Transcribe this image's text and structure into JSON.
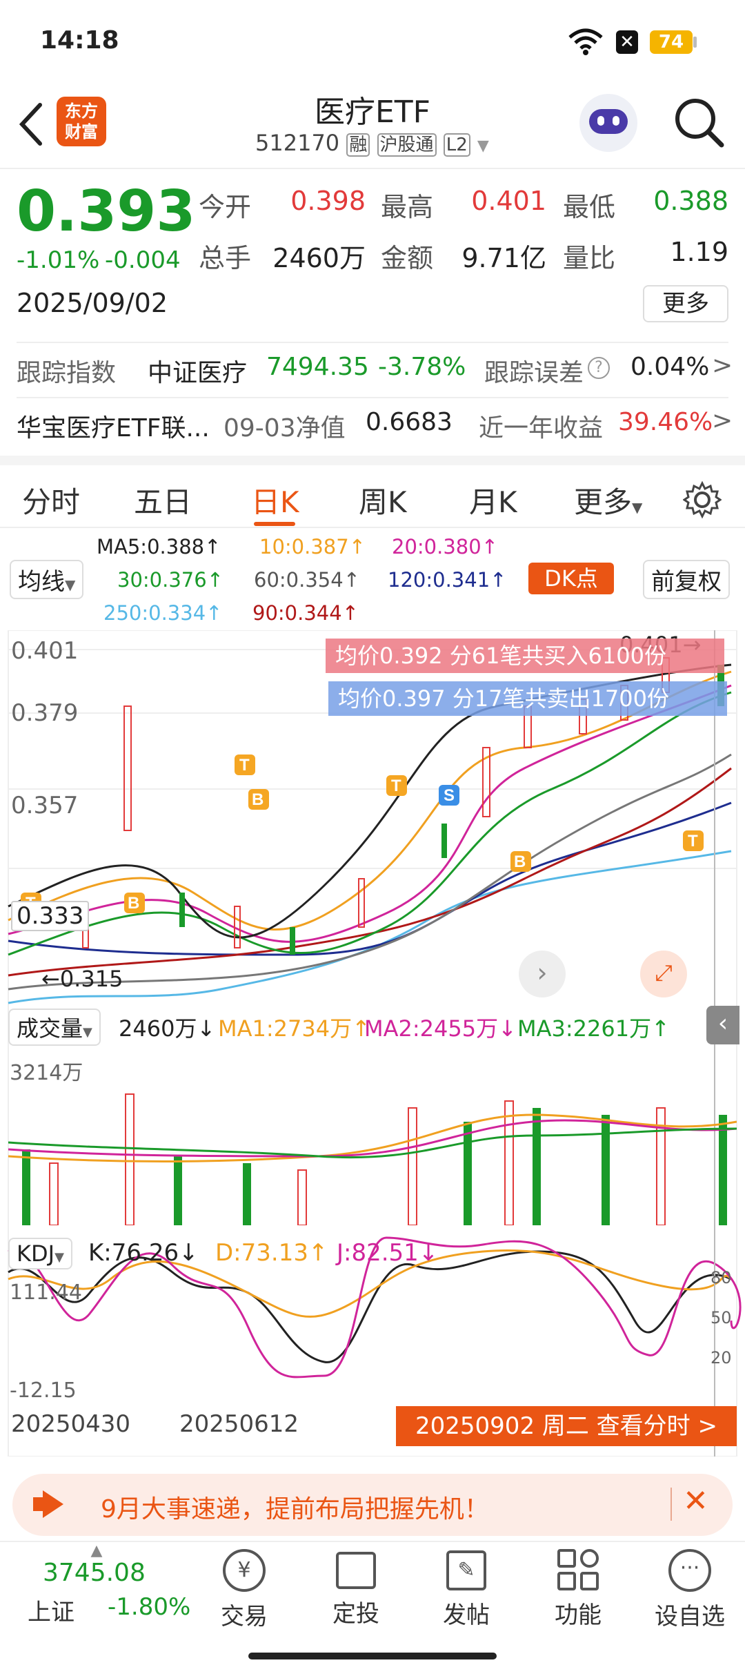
{
  "status_bar": {
    "time": "14:18",
    "battery": "74"
  },
  "header": {
    "logo_line1": "东方",
    "logo_line2": "财富",
    "title": "医疗ETF",
    "code": "512170",
    "tag_margin": "融",
    "tag_connect": "沪股通",
    "tag_level": "L2"
  },
  "quote": {
    "price": "0.393",
    "change_pct": "-1.01%",
    "change": "-0.004",
    "date": "2025/09/02",
    "open_label": "今开",
    "open": "0.398",
    "high_label": "最高",
    "high": "0.401",
    "low_label": "最低",
    "low": "0.388",
    "volume_label": "总手",
    "volume": "2460万",
    "amount_label": "金额",
    "amount": "9.71亿",
    "ratio_label": "量比",
    "ratio": "1.19",
    "more_button": "更多",
    "track_label": "跟踪指数",
    "track_index": "中证医疗",
    "track_value": "7494.35",
    "track_change": "-3.78%",
    "track_error_label": "跟踪误差",
    "track_error": "0.04%",
    "link_fund": "华宝医疗ETF联...",
    "nav_label": "09-03净值",
    "nav_value": "0.6683",
    "annual_label": "近一年收益",
    "annual_value": "39.46%"
  },
  "tabs": [
    "分时",
    "五日",
    "日K",
    "周K",
    "月K",
    "更多"
  ],
  "active_tab": "日K",
  "chart": {
    "ma_selector": "均线",
    "ma5": "MA5:0.388↑",
    "ma10": "10:0.387↑",
    "ma20": "20:0.380↑",
    "ma30": "30:0.376↑",
    "ma60": "60:0.354↑",
    "ma120": "120:0.341↑",
    "ma250": "250:0.334↑",
    "ma90": "90:0.344↑",
    "dk_button": "DK点",
    "adjust_button": "前复权",
    "y_top": "0.401",
    "y_2": "0.379",
    "y_3": "0.357",
    "cross_price": "0.333",
    "low_mark": "0.315",
    "high_mark": "0.401",
    "buy_tooltip": "均价0.392  分61笔共买入6100份",
    "sell_tooltip": "均价0.397  分17笔共卖出1700份",
    "vol_selector": "成交量",
    "vol_value": "2460万↓",
    "vol_ma1": "MA1:2734万↑",
    "vol_ma2": "MA2:2455万↓",
    "vol_ma3": "MA3:2261万↑",
    "vol_top": "3214万",
    "kdj_selector": "KDJ",
    "kdj_k": "K:76.26↓",
    "kdj_d": "D:73.13↑",
    "kdj_j": "J:82.51↓",
    "kdj_top": "111.44",
    "kdj_bottom": "-12.15",
    "kdj_80": "80",
    "kdj_50": "50",
    "kdj_20": "20",
    "date_left": "20250430",
    "date_mid": "20250612",
    "date_bar": "20250902 周二 查看分时 >",
    "colors": {
      "ma5": "#222",
      "ma10": "#f0a020",
      "ma20": "#d0249a",
      "ma30": "#1a9a2a",
      "ma60": "#777",
      "ma120": "#1e2d8f",
      "ma250": "#56b8e6",
      "ma90": "#b01818"
    }
  },
  "banner": {
    "text": "9月大事速递，提前布局把握先机！"
  },
  "bottom_nav": {
    "index_value": "3745.08",
    "index_name": "上证",
    "index_change": "-1.80%",
    "items": [
      "交易",
      "定投",
      "发帖",
      "功能",
      "设自选"
    ]
  }
}
